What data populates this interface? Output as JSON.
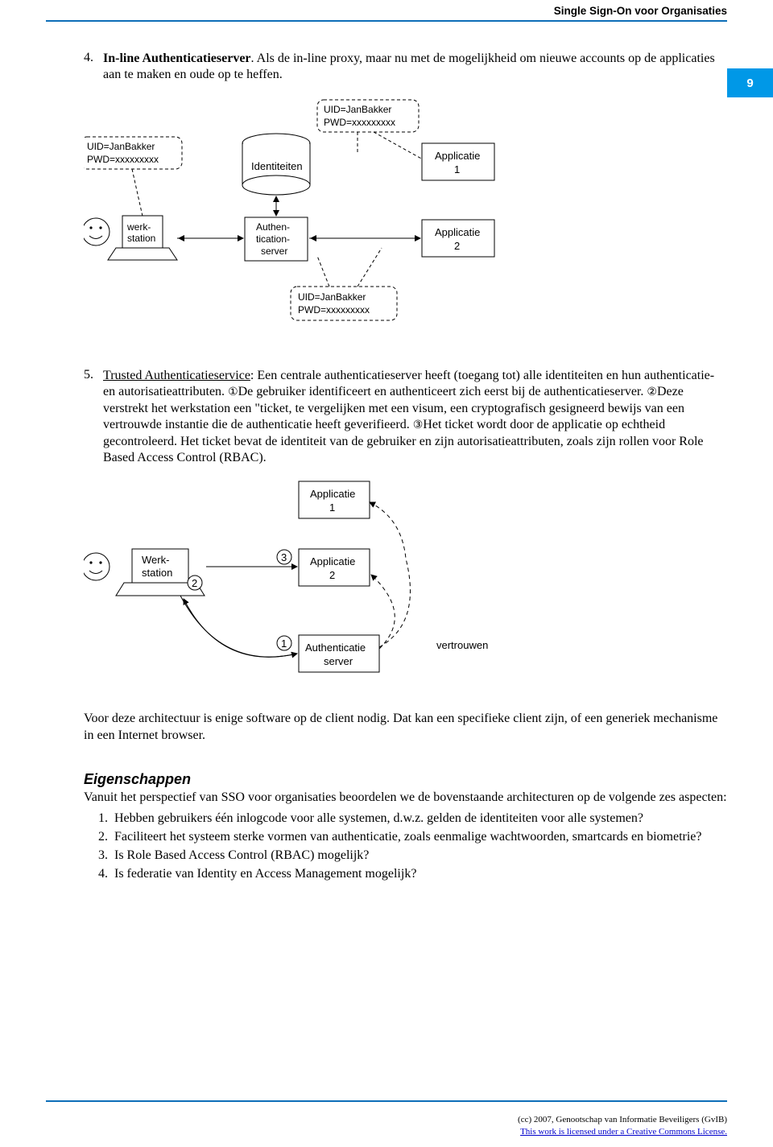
{
  "header": {
    "running_title": "Single Sign-On voor Organisaties"
  },
  "page_number": "9",
  "section4": {
    "num": "4.",
    "title": "In-line Authenticatieserver",
    "body": ". Als de in-line proxy, maar nu met de mogelijkheid om nieuwe accounts op de applicaties aan te maken en oude op te heffen."
  },
  "diagram1": {
    "bubble_top": {
      "l1": "UID=JanBakker",
      "l2": "PWD=xxxxxxxxx"
    },
    "bubble_left": {
      "l1": "UID=JanBakker",
      "l2": "PWD=xxxxxxxxx"
    },
    "bubble_bottom": {
      "l1": "UID=JanBakker",
      "l2": "PWD=xxxxxxxxx"
    },
    "identiteiten": "Identiteiten",
    "werkstation": {
      "l1": "werk-",
      "l2": "station"
    },
    "auth": {
      "l1": "Authen-",
      "l2": "tication-",
      "l3": "server"
    },
    "app1": {
      "l1": "Applicatie",
      "l2": "1"
    },
    "app2": {
      "l1": "Applicatie",
      "l2": "2"
    }
  },
  "section5": {
    "num": "5.",
    "title": "Trusted Authenticatieservice",
    "body_a": ": Een centrale authenticatieserver heeft (toegang tot) alle identiteiten en hun authenticatie- en autorisatieattributen. ",
    "body_b": "De gebruiker identificeert en authenticeert zich eerst bij de authenticatieserver. ",
    "body_c": "Deze verstrekt het werkstation een \"ticket, te vergelijken met een visum, een cryptografisch gesigneerd bewijs van een vertrouwde instantie die de authenticatie heeft geverifieerd. ",
    "body_d": "Het ticket wordt door de applicatie op echtheid gecontroleerd. Het ticket bevat de identiteit van de gebruiker en zijn autorisatieattributen, zoals zijn rollen voor Role Based Access Control (RBAC)."
  },
  "diagram2": {
    "werkstation": {
      "l1": "Werk-",
      "l2": "station"
    },
    "app1": {
      "l1": "Applicatie",
      "l2": "1"
    },
    "app2": {
      "l1": "Applicatie",
      "l2": "2"
    },
    "auth": {
      "l1": "Authenticatie",
      "l2": "server"
    },
    "vertrouwen": "vertrouwen",
    "c1": "①",
    "c2": "②",
    "c3": "③"
  },
  "para_client": "Voor deze architectuur is enige software op de client nodig. Dat kan een specifieke client zijn, of een generiek mechanisme in een Internet browser.",
  "eigenschappen": {
    "heading": "Eigenschappen",
    "intro": "Vanuit het perspectief van SSO voor organisaties beoordelen we de bovenstaande architecturen op de volgende zes aspecten:",
    "items": [
      "Hebben gebruikers één inlogcode voor alle systemen, d.w.z. gelden de identiteiten voor alle systemen?",
      "Faciliteert het systeem sterke vormen van authenticatie, zoals eenmalige wachtwoorden, smartcards en biometrie?",
      "Is Role Based Access Control (RBAC) mogelijk?",
      "Is federatie van Identity en Access Management mogelijk?"
    ]
  },
  "footer": {
    "line1": "(cc) 2007, Genootschap van Informatie Beveiligers (GvIB)",
    "line2": "This work is licensed under a Creative Commons License."
  }
}
